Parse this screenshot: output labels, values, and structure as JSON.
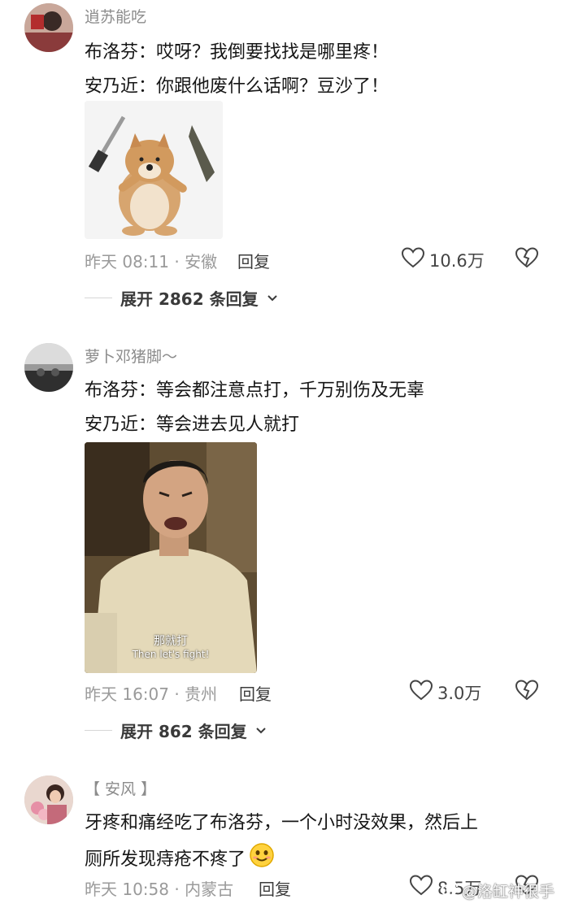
{
  "comments": [
    {
      "username": "逍苏能吃",
      "lines": [
        "布洛芬：哎呀？我倒要找找是哪里疼！",
        "安乃近：你跟他废什么话啊？豆沙了！"
      ],
      "meta": "昨天 08:11 · 安徽",
      "reply_label": "回复",
      "likes": "10.6万",
      "expand_label": "展开 2862 条回复",
      "image_alt": "sticker-dog-with-knife-and-shield"
    },
    {
      "username": "萝卜邓猪脚～",
      "lines": [
        "布洛芬：等会都注意点打，千万别伤及无辜",
        "安乃近：等会进去见人就打"
      ],
      "meta": "昨天 16:07 · 贵州",
      "reply_label": "回复",
      "likes": "3.0万",
      "expand_label": "展开 862 条回复",
      "subtitle_cn": "那就打",
      "subtitle_en": "Then let's fight!"
    },
    {
      "username": "【 安风 】",
      "lines": [
        "牙疼和痛经吃了布洛芬，一个小时没效果，然后上",
        "厕所发现痔疮不疼了"
      ],
      "meta": "昨天 10:58 · 内蒙古",
      "reply_label": "回复",
      "likes": "8.5万"
    }
  ],
  "watermark": "@洛缸神很手",
  "colors": {
    "meta": "#9a9a9a",
    "username": "#8c8c8c",
    "text": "#161616"
  }
}
